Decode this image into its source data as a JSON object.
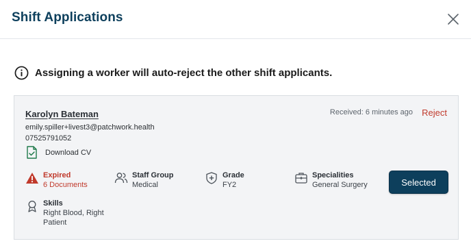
{
  "modal": {
    "title": "Shift Applications",
    "close_icon": "close-icon"
  },
  "notice": {
    "icon": "info-icon",
    "text": "Assigning a worker will auto-reject the other shift applicants."
  },
  "applicant": {
    "name": "Karolyn Bateman",
    "email": "emily.spiller+livest3@patchwork.health",
    "phone": "07525791052",
    "cv_label": "Download CV",
    "received": "Received: 6 minutes ago",
    "reject_label": "Reject",
    "status": {
      "label": "Expired",
      "value": "6 Documents",
      "icon": "warning-icon"
    },
    "staff_group": {
      "label": "Staff Group",
      "value": "Medical",
      "icon": "people-icon"
    },
    "grade": {
      "label": "Grade",
      "value": "FY2",
      "icon": "shield-plus-icon"
    },
    "specialities": {
      "label": "Specialities",
      "value": "General Surgery",
      "icon": "medical-bag-icon"
    },
    "skills": {
      "label": "Skills",
      "value": "Right Blood, Right Patient",
      "icon": "award-icon"
    },
    "selected_label": "Selected"
  },
  "colors": {
    "primary": "#0d3f5c",
    "danger": "#c0392b",
    "card_bg": "#f3f4f6"
  }
}
